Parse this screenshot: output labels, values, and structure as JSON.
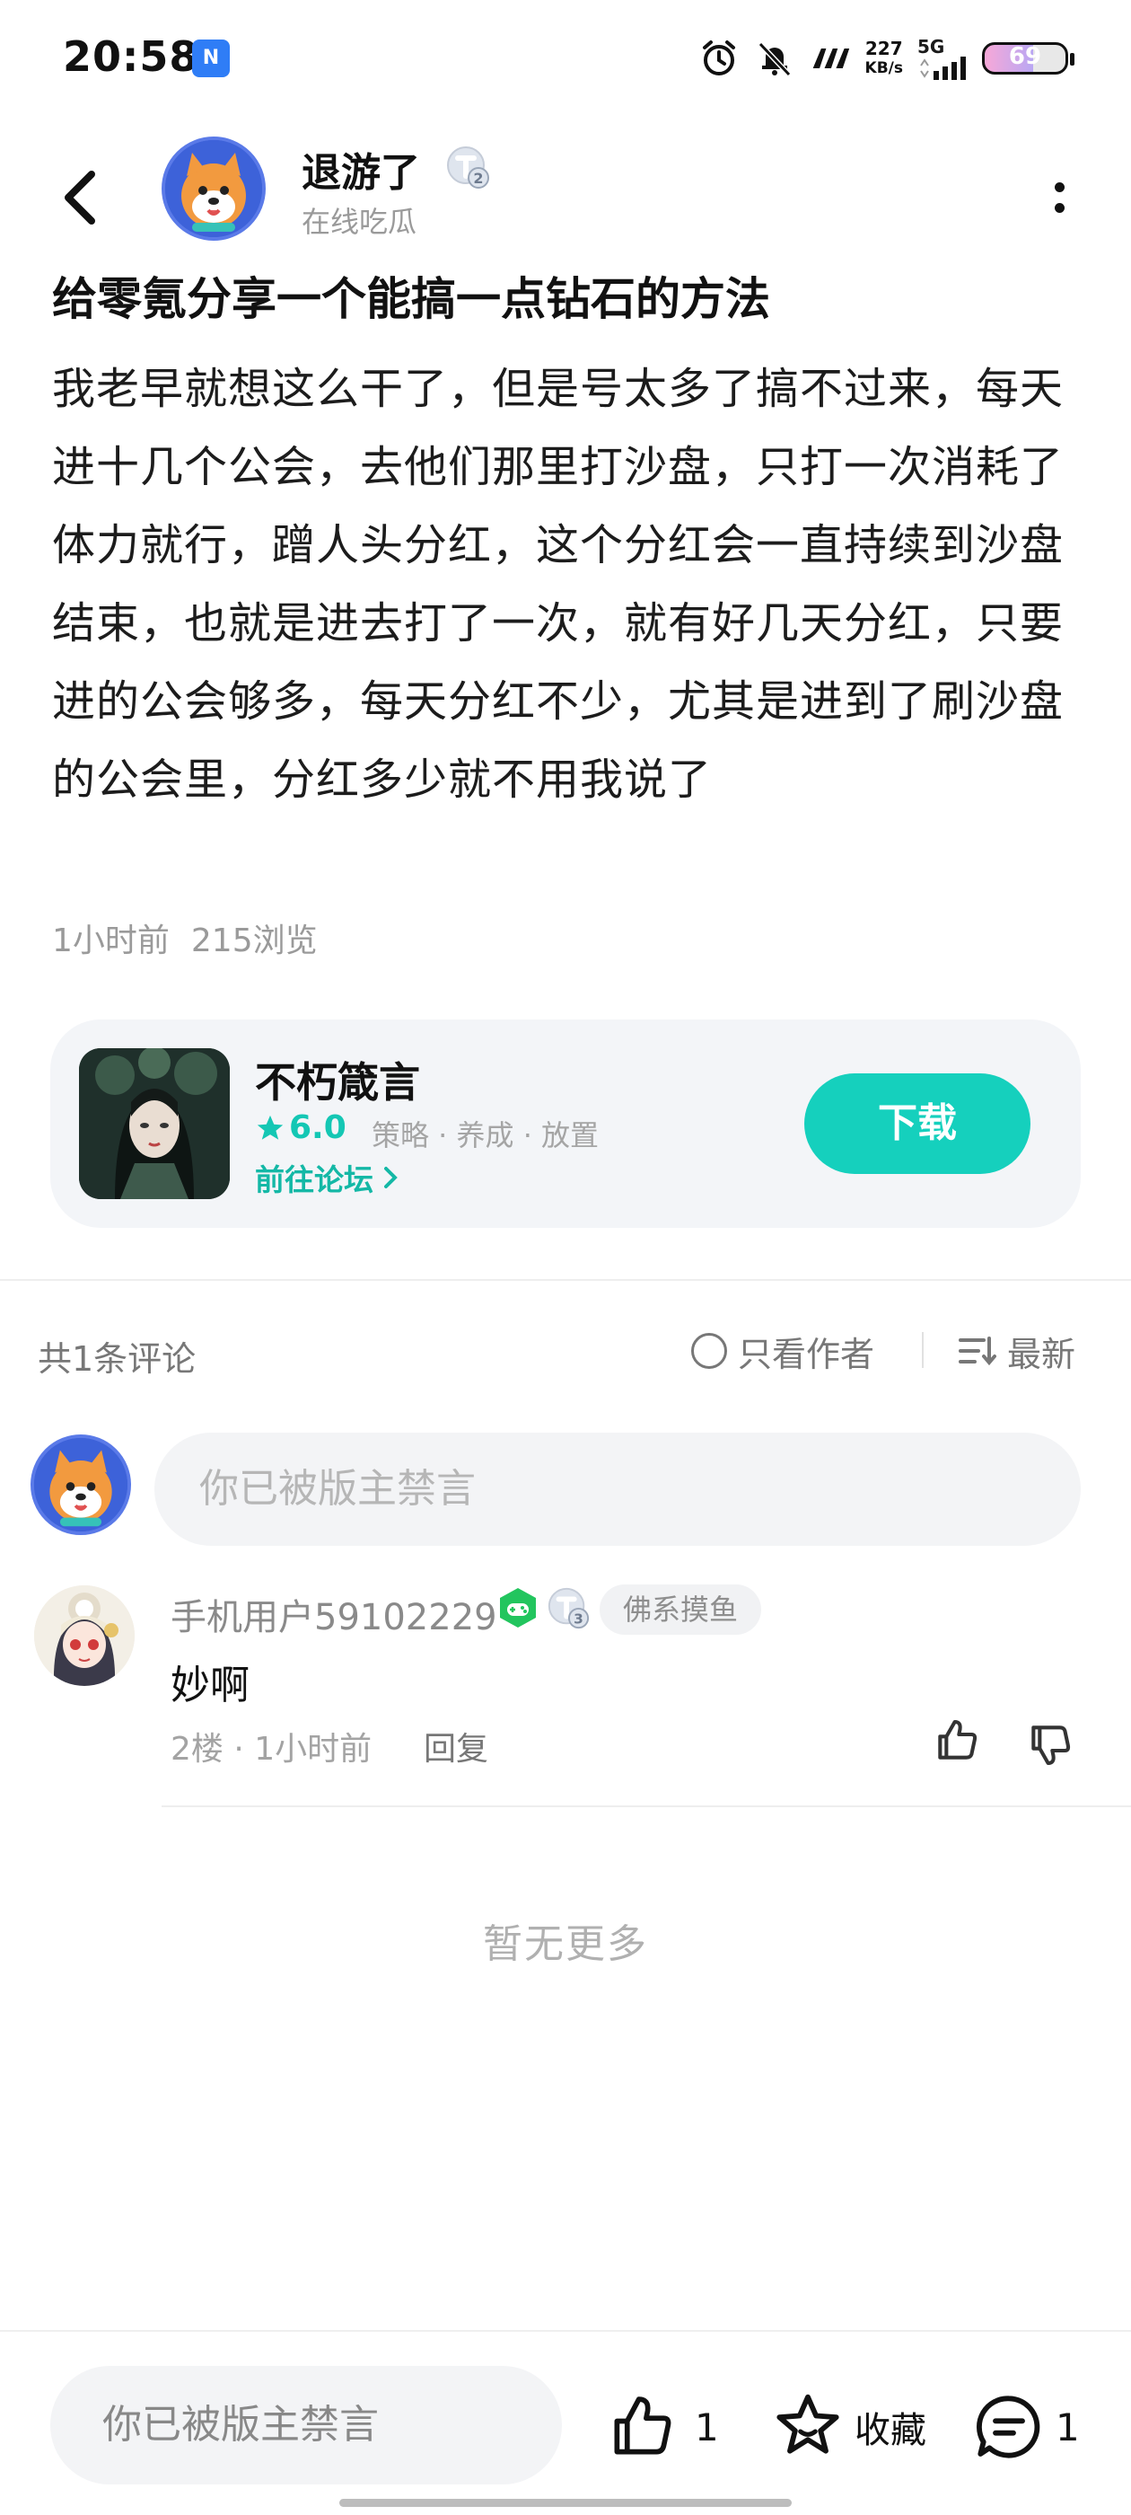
{
  "status_bar": {
    "time": "20:58",
    "nfc_icon": "nfc-icon",
    "alarm_icon": "alarm-icon",
    "mute_icon": "bell-off-icon",
    "speed_value": "227",
    "speed_unit": "KB/s",
    "network": "5G",
    "battery": "69"
  },
  "header": {
    "back_icon": "chevron-left-icon",
    "author_name": "退游了",
    "author_level": "2",
    "author_status": "在线吃瓜",
    "more_icon": "more-vertical-icon"
  },
  "post": {
    "title": "给零氪分享一个能搞一点钻石的方法",
    "body": "我老早就想这么干了，但是号太多了搞不过来，每天进十几个公会，去他们那里打沙盘，只打一次消耗了体力就行，蹭人头分红，这个分红会一直持续到沙盘结束，也就是进去打了一次，就有好几天分红，只要进的公会够多，每天分红不少，尤其是进到了刷沙盘的公会里，分红多少就不用我说了",
    "time_ago": "1小时前",
    "views": "215浏览"
  },
  "game_card": {
    "name": "不朽箴言",
    "score": "6.0",
    "tags": "策略 · 养成 · 放置",
    "forum_link": "前往论坛",
    "download_label": "下载",
    "accent_color": "#15d0bd"
  },
  "comments_header": {
    "count_label": "共1条评论",
    "author_only_label": "只看作者",
    "sort_label": "最新"
  },
  "comment_input": {
    "placeholder": "你已被版主禁言"
  },
  "comments": [
    {
      "user": "手机用户59102229",
      "level": "3",
      "tag": "佛系摸鱼",
      "text": "妙啊",
      "floor_time": "2楼 · 1小时前",
      "reply_label": "回复"
    }
  ],
  "no_more_label": "暂无更多",
  "bottom_bar": {
    "input_placeholder": "你已被版主禁言",
    "like_count": "1",
    "favorite_label": "收藏",
    "comment_count": "1"
  }
}
